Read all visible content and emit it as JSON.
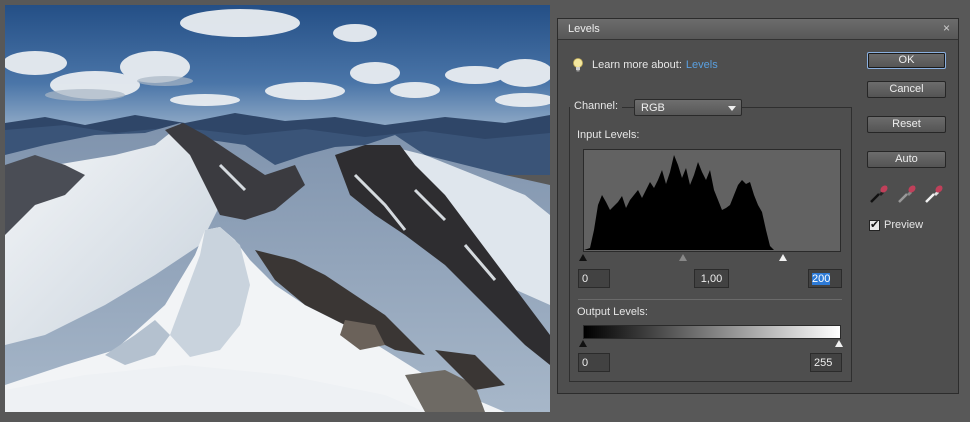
{
  "dialog": {
    "title": "Levels",
    "close_glyph": "×",
    "learn_prefix": "Learn more about:",
    "learn_link": "Levels",
    "channel_label": "Channel:",
    "channel_value": "RGB",
    "input_levels_label": "Input Levels:",
    "output_levels_label": "Output Levels:",
    "input_values": {
      "black": "0",
      "gamma": "1,00",
      "white": "200"
    },
    "output_values": {
      "black": "0",
      "white": "255"
    },
    "buttons": {
      "ok": "OK",
      "cancel": "Cancel",
      "reset": "Reset",
      "auto": "Auto"
    },
    "preview_label": "Preview",
    "preview_checked": true,
    "icons": {
      "info": "lightbulb-icon",
      "black_eyedropper": "black-eyedropper-icon",
      "gray_eyedropper": "gray-eyedropper-icon",
      "white_eyedropper": "white-eyedropper-icon"
    }
  },
  "colors": {
    "dialog_bg": "#4e4e4e",
    "link": "#5aa0e0",
    "selection": "#2d7ad6",
    "eyedropper": "#c0405a"
  }
}
